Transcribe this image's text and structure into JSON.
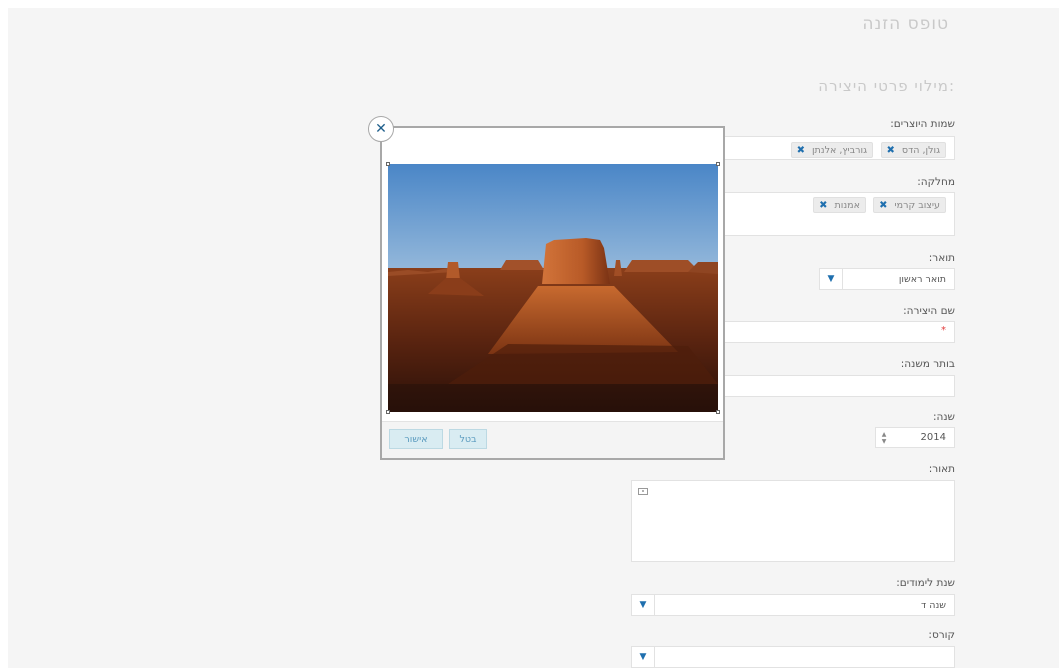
{
  "page": {
    "title": "טופס הזנה",
    "section_title": "מילוי פרטי היצירה:"
  },
  "form": {
    "creators": {
      "label": "שמות היוצרים:",
      "tags": [
        "גולן, הדס",
        "גורביץ, אלנתן"
      ]
    },
    "department": {
      "label": "מחלקה:",
      "tags": [
        "עיצוב קרמי",
        "אמנות"
      ]
    },
    "degree": {
      "label": "תואר:",
      "value": "תואר ראשון"
    },
    "work_name": {
      "label": "שם היצירה:",
      "required_mark": "*"
    },
    "subtitle": {
      "label": "בותר משנה:"
    },
    "year": {
      "label": "שנה:",
      "value": "2014"
    },
    "description": {
      "label": "תאור:"
    },
    "study_year": {
      "label": "שנת לימודים:",
      "value": "שנה ד"
    },
    "course": {
      "label": "קורס:",
      "value": ""
    }
  },
  "modal": {
    "confirm_label": "אישור",
    "cancel_label": "בטל",
    "close_icon": "close-icon"
  },
  "colors": {
    "accent": "#1f6fae",
    "button_bg": "#d9ecf2",
    "button_text": "#5b9bbf",
    "required": "#e23c3c"
  }
}
